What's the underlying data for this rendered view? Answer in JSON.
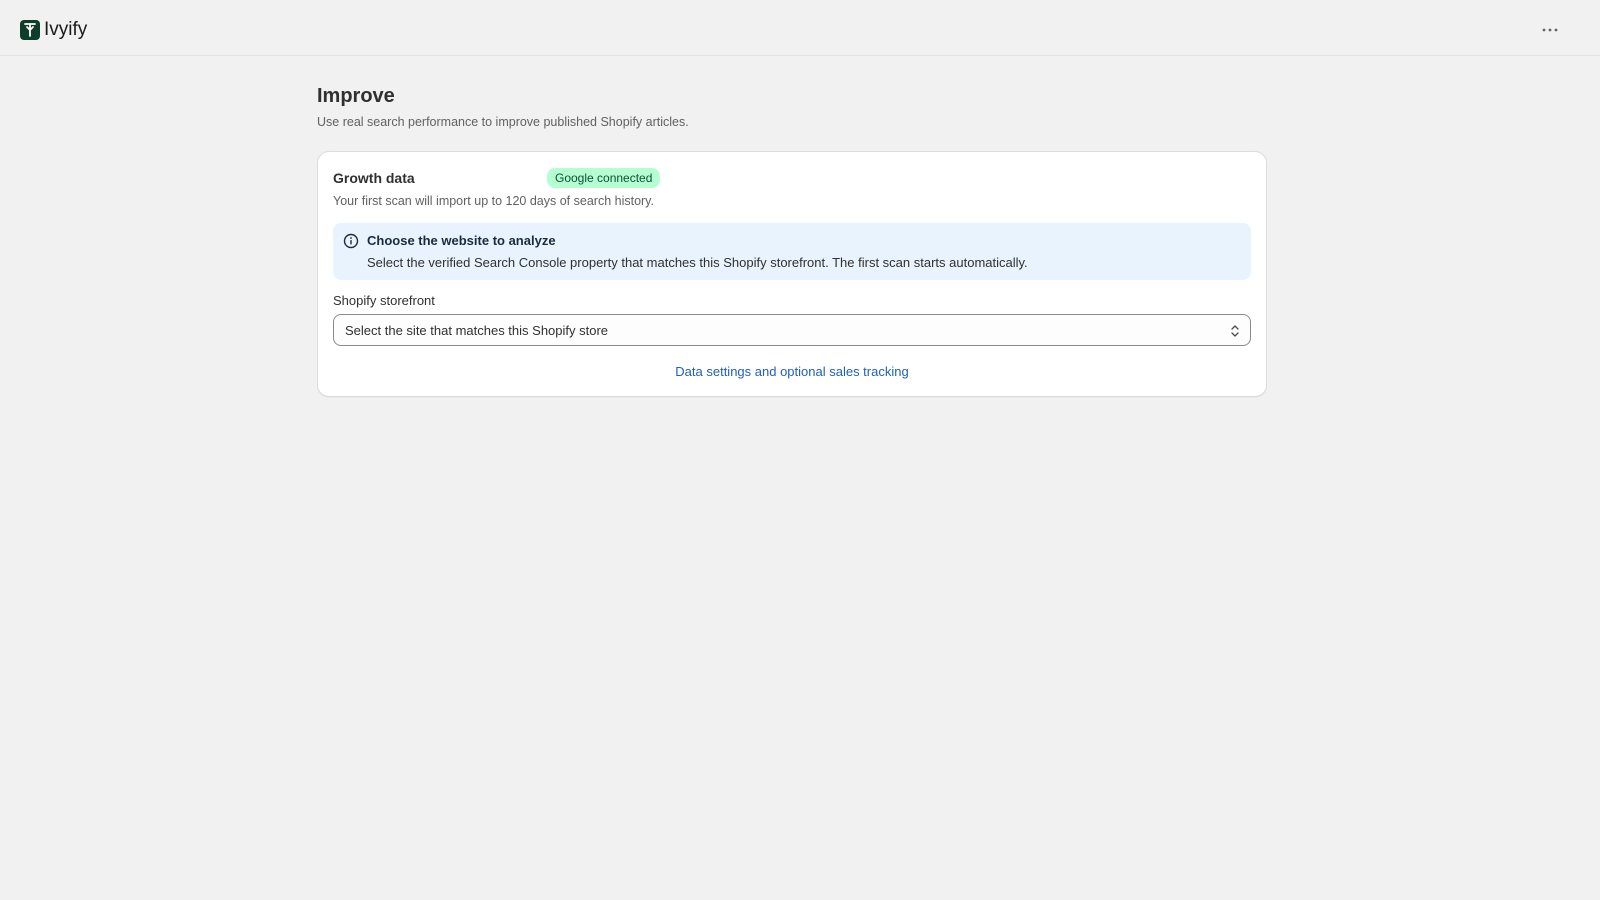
{
  "app": {
    "name": "Ivyify",
    "more_actions_icon": "ellipsis-horizontal-icon"
  },
  "page": {
    "title": "Improve",
    "subtitle": "Use real search performance to improve published Shopify articles."
  },
  "growth_card": {
    "title": "Growth data",
    "badge": "Google connected",
    "description": "Your first scan will import up to 120 days of search history.",
    "banner": {
      "icon": "info-icon",
      "title": "Choose the website to analyze",
      "text": "Select the verified Search Console property that matches this Shopify storefront. The first scan starts automatically."
    },
    "storefront_field": {
      "label": "Shopify storefront",
      "selected_value": "Select the site that matches this Shopify store",
      "icon": "select-chevrons-icon"
    },
    "settings_link": "Data settings and optional sales tracking"
  },
  "colors": {
    "background": "#f1f1f1",
    "card": "#ffffff",
    "badge_bg": "#b4fed2",
    "badge_text": "#0c5132",
    "banner_bg": "#e8f3fd",
    "link": "#1f5fbf",
    "brand": "#0f3d2b"
  }
}
